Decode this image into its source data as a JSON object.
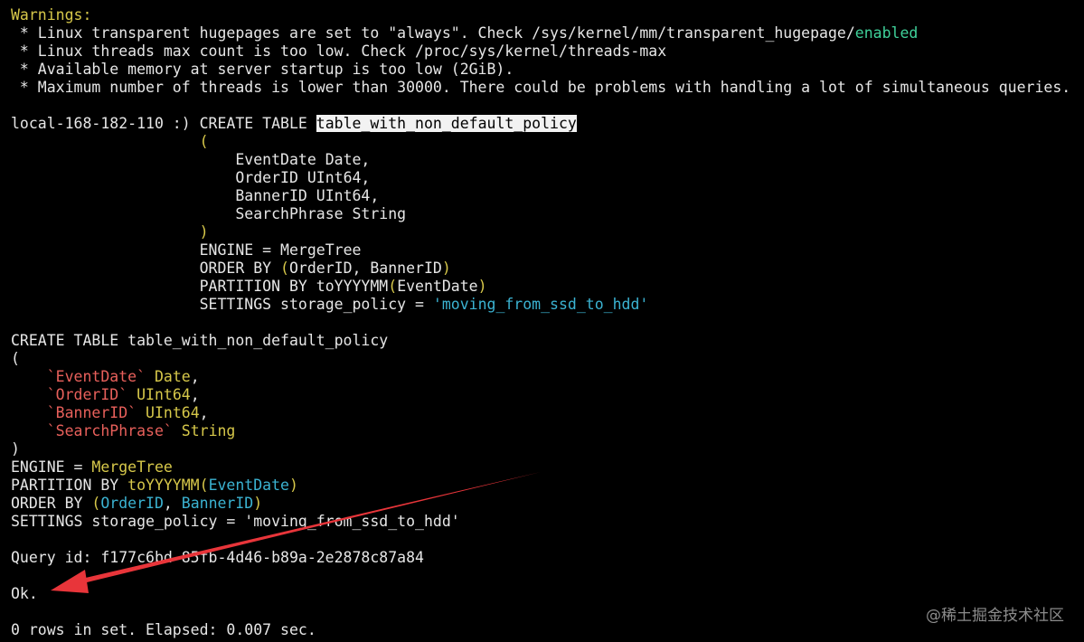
{
  "colors": {
    "background": "#000000",
    "text": "#e6e6e6",
    "keyword_yellow": "#d7c84a",
    "string_green": "#3fd19a",
    "identifier_red": "#e8605b",
    "ident_cyan": "#3bb3d2",
    "annotation_arrow": "#e8353a",
    "selection_bg": "#f2f2f2"
  },
  "warnings": {
    "header": "Warnings:",
    "lines": [
      {
        "prefix": " * Linux transparent hugepages are set to \"always\". Check /sys/kernel/mm/transparent_hugepage/",
        "suffix": "enabled"
      },
      {
        "prefix": " * Linux threads max count is too low. Check /proc/sys/kernel/threads-max",
        "suffix": ""
      },
      {
        "prefix": " * Available memory at server startup is too low (2GiB).",
        "suffix": ""
      },
      {
        "prefix": " * Maximum number of threads is lower than 30000. There could be problems with handling a lot of simultaneous queries.",
        "suffix": ""
      }
    ]
  },
  "query_input": {
    "prompt": "local-168-182-110 :) ",
    "create": "CREATE TABLE ",
    "table_name": "table_with_non_default_policy",
    "indent": "                     ",
    "open_paren": "(",
    "columns": [
      "    EventDate Date,",
      "    OrderID UInt64,",
      "    BannerID UInt64,",
      "    SearchPhrase String"
    ],
    "close_paren": ")",
    "engine": "ENGINE = MergeTree",
    "order_kw": "ORDER BY ",
    "order_open": "(",
    "order_cols": "OrderID, BannerID",
    "order_close": ")",
    "partition_kw": "PARTITION BY toYYYYMM",
    "partition_open": "(",
    "partition_col": "EventDate",
    "partition_close": ")",
    "settings_kw": "SETTINGS storage_policy = ",
    "settings_value": "'moving_from_ssd_to_hdd'"
  },
  "formatted_query": {
    "create_line": "CREATE TABLE table_with_non_default_policy",
    "open_paren": "(",
    "columns": [
      {
        "indent": "    ",
        "name": "`EventDate`",
        "type": " Date",
        "sep": ","
      },
      {
        "indent": "    ",
        "name": "`OrderID`",
        "type": " UInt64",
        "sep": ","
      },
      {
        "indent": "    ",
        "name": "`BannerID`",
        "type": " UInt64",
        "sep": ","
      },
      {
        "indent": "    ",
        "name": "`SearchPhrase`",
        "type": " String",
        "sep": ""
      }
    ],
    "close_paren": ")",
    "engine_kw": "ENGINE = ",
    "engine_val": "MergeTree",
    "partition_kw": "PARTITION BY ",
    "partition_fn": "toYYYYMM",
    "partition_open": "(",
    "partition_col": "EventDate",
    "partition_close": ")",
    "order_kw": "ORDER BY ",
    "order_open": "(",
    "order_col1": "OrderID",
    "order_sep": ", ",
    "order_col2": "BannerID",
    "order_close": ")",
    "settings": "SETTINGS storage_policy = 'moving_from_ssd_to_hdd'"
  },
  "result": {
    "query_id": "Query id: f177c6bd-85fb-4d46-b89a-2e2878c87a84",
    "ok": "Ok.",
    "summary": "0 rows in set. Elapsed: 0.007 sec."
  },
  "watermark": "@稀土掘金技术社区"
}
